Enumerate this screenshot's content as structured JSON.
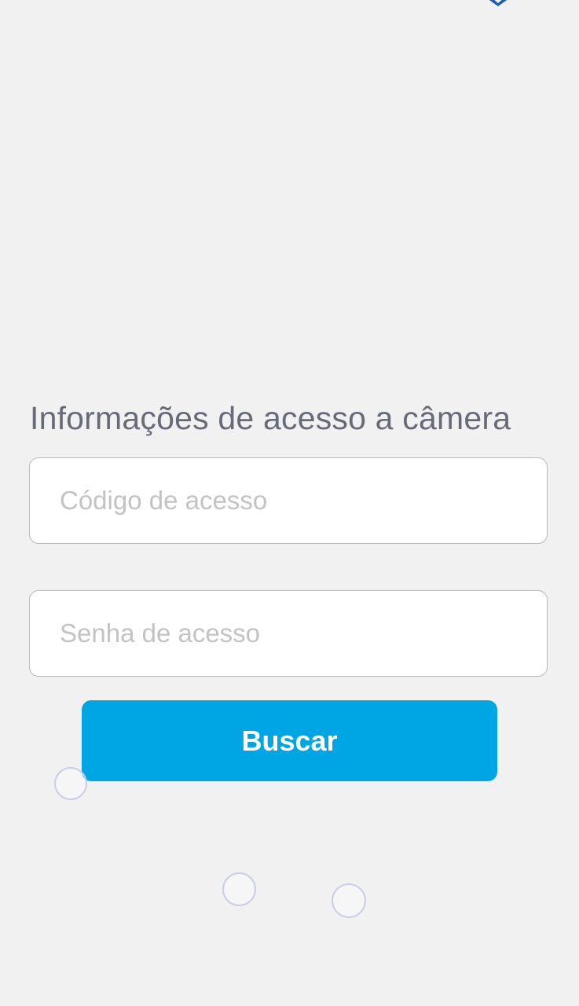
{
  "access_section": {
    "title": "Informações de acesso a câmera",
    "code_field": {
      "value": "",
      "placeholder": "Código de acesso"
    },
    "password_field": {
      "value": "",
      "placeholder": "Senha de acesso"
    },
    "search_button_label": "Buscar"
  },
  "colors": {
    "background": "#f1f1f1",
    "title_text": "#676b78",
    "placeholder_text": "#c3c3c6",
    "button_background": "#00a6e3",
    "button_text": "#ffffff",
    "logo_fragment": "#1f5ea8"
  },
  "icons": {
    "top_logo": "logo-fragment-icon"
  }
}
